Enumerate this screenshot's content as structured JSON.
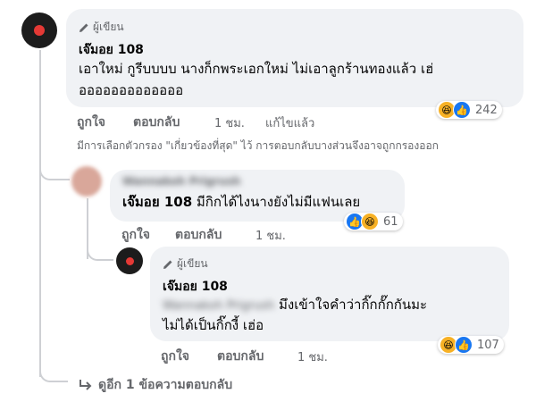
{
  "comment1": {
    "author_tag": "ผู้เขียน",
    "name": "เจ๊มอย 108",
    "text_line1": "เอาใหม่ กูรีบบบบ นางก็กพระเอกใหม่ ไม่เอาลูกร้านทองแล้ว เฮ่",
    "text_line2": "อออออออออออออ",
    "actions": {
      "like": "ถูกใจ",
      "reply": "ตอบกลับ",
      "time": "1 ชม.",
      "edited": "แก้ไขแล้ว"
    },
    "reactions": {
      "icons": [
        "haha-icon",
        "like-icon"
      ],
      "count": "242"
    }
  },
  "filter_notice": "มีการเลือกตัวกรอง \"เกี่ยวข้องที่สุด\" ไว้ การตอบกลับบางส่วนจึงอาจถูกกรองออก",
  "reply1": {
    "blurred_name": "Wannakoh Prigrush",
    "mention": "เจ๊มอย 108",
    "text": " มีกิกได้ไงนางยังไม่มีแฟนเลย",
    "actions": {
      "like": "ถูกใจ",
      "reply": "ตอบกลับ",
      "time": "1 ชม."
    },
    "reactions": {
      "icons": [
        "like-icon",
        "haha-icon"
      ],
      "count": "61"
    }
  },
  "reply2": {
    "author_tag": "ผู้เขียน",
    "name": "เจ๊มอย 108",
    "blurred_mention": "Wannakoh Prigrush",
    "text_line1": " มึงเข้าใจคำว่ากิ๊กกั๊กกันมะ",
    "text_line2": "ไม่ได้เป็นกิ๊กงี้ เฮ่อ",
    "actions": {
      "like": "ถูกใจ",
      "reply": "ตอบกลับ",
      "time": "1 ชม."
    },
    "reactions": {
      "icons": [
        "haha-icon",
        "like-icon"
      ],
      "count": "107"
    }
  },
  "more_replies": "ดูอีก 1 ข้อความตอบกลับ"
}
